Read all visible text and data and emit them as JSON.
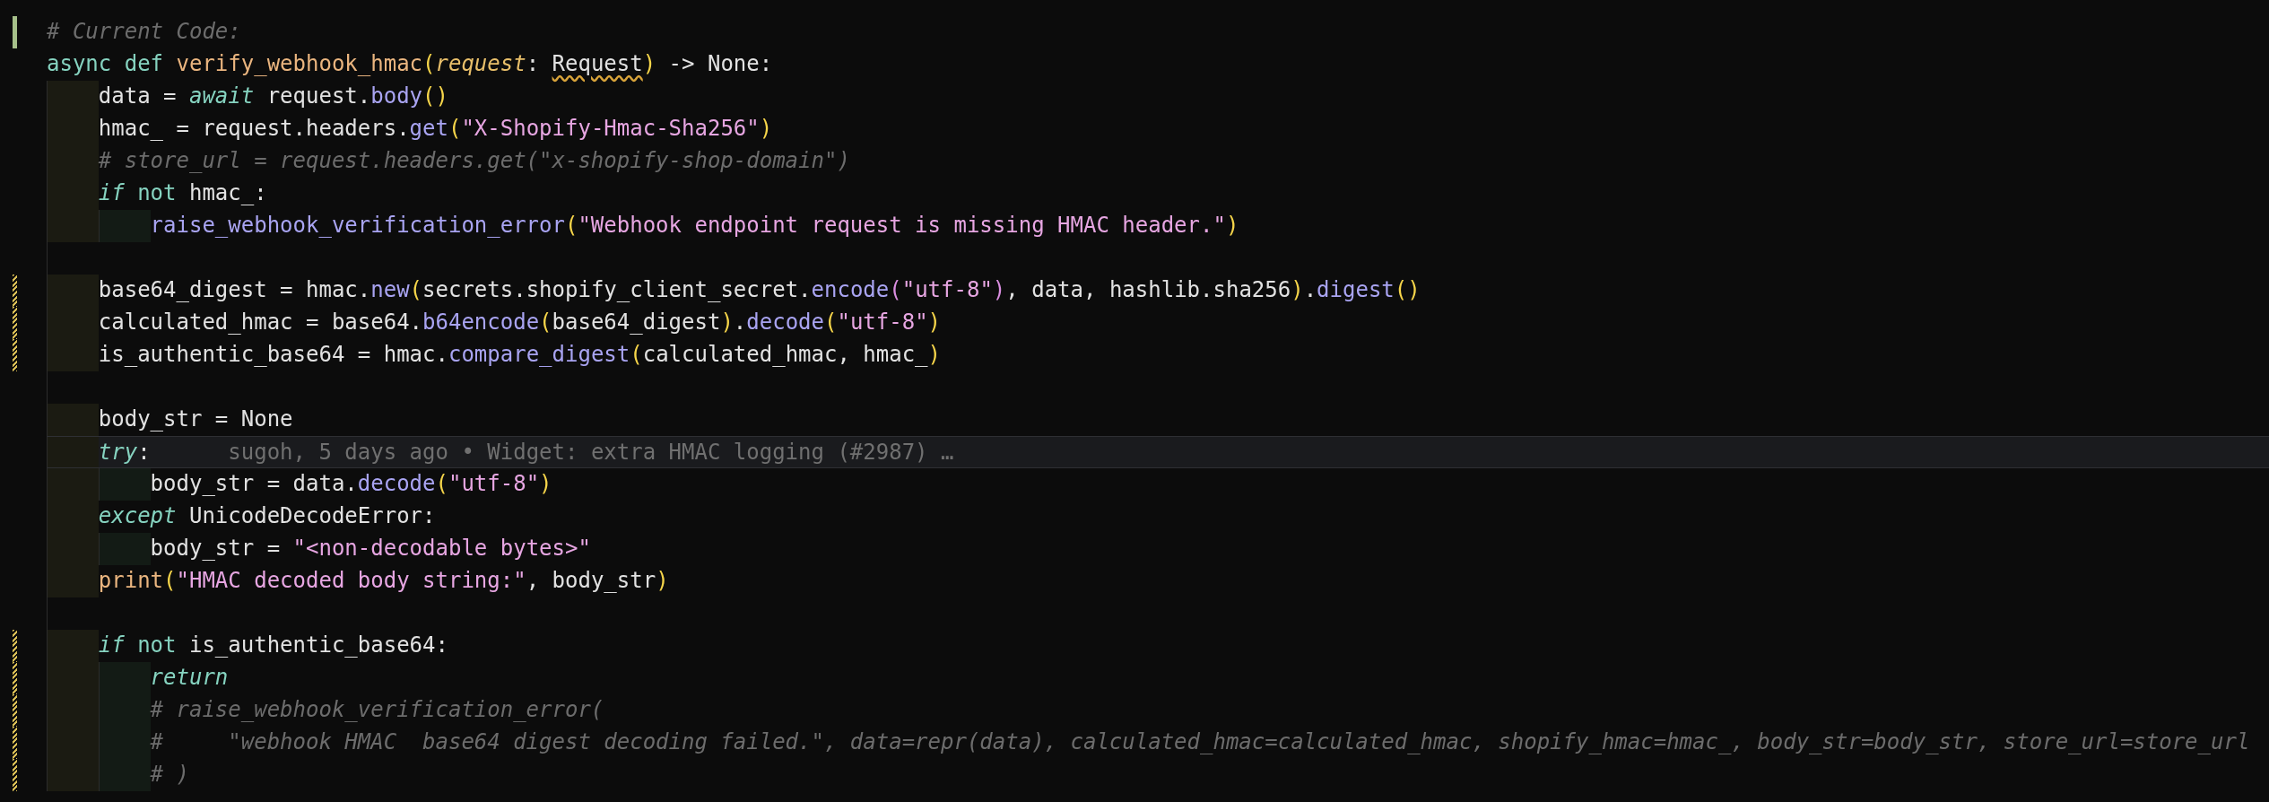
{
  "editor": {
    "lines": [
      {
        "added": true,
        "modified": false,
        "current": false,
        "tokens": [
          {
            "text": "# Current Code:",
            "color": "#6c6c6c",
            "kind": "italic"
          }
        ]
      },
      {
        "added": false,
        "modified": false,
        "current": false,
        "tokens": [
          {
            "text": "async def ",
            "color": "#86d3c0",
            "kind": "plain"
          },
          {
            "text": "verify_webhook_hmac",
            "color": "#eab57f",
            "kind": "plain"
          },
          {
            "text": "(",
            "color": "#f6d54a",
            "kind": "plain"
          },
          {
            "text": "request",
            "color": "#e8bf6a",
            "kind": "italic"
          },
          {
            "text": ": ",
            "color": "#e2e2e2",
            "kind": "plain"
          },
          {
            "text": "Request",
            "color": "#e2e2e2",
            "kind": "warned"
          },
          {
            "text": ")",
            "color": "#f6d54a",
            "kind": "plain"
          },
          {
            "text": " -> None:",
            "color": "#e2e2e2",
            "kind": "plain"
          }
        ],
        "children": [
          {
            "added": false,
            "modified": false,
            "current": false,
            "tokens": [
              {
                "text": "data = ",
                "color": "#e2e2e2",
                "kind": "plain"
              },
              {
                "text": "await",
                "color": "#86d3c0",
                "kind": "italic"
              },
              {
                "text": " request.",
                "color": "#e2e2e2",
                "kind": "plain"
              },
              {
                "text": "body",
                "color": "#a9a4f2",
                "kind": "plain"
              },
              {
                "text": "()",
                "color": "#f6d54a",
                "kind": "plain"
              }
            ]
          },
          {
            "added": false,
            "modified": false,
            "current": false,
            "tokens": [
              {
                "text": "hmac_ = request.headers.",
                "color": "#e2e2e2",
                "kind": "plain"
              },
              {
                "text": "get",
                "color": "#a9a4f2",
                "kind": "plain"
              },
              {
                "text": "(",
                "color": "#f6d54a",
                "kind": "plain"
              },
              {
                "text": "\"X-Shopify-Hmac-Sha256\"",
                "color": "#e7a6e2",
                "kind": "plain"
              },
              {
                "text": ")",
                "color": "#f6d54a",
                "kind": "plain"
              }
            ]
          },
          {
            "added": false,
            "modified": false,
            "current": false,
            "tokens": [
              {
                "text": "# store_url = request.headers.get(\"x-shopify-shop-domain\")",
                "color": "#6c6c6c",
                "kind": "italic"
              }
            ]
          },
          {
            "added": false,
            "modified": false,
            "current": false,
            "tokens": [
              {
                "text": "if",
                "color": "#86d3c0",
                "kind": "italic"
              },
              {
                "text": " not",
                "color": "#86d3c0",
                "kind": "plain"
              },
              {
                "text": " hmac_:",
                "color": "#e2e2e2",
                "kind": "plain"
              }
            ],
            "children": [
              {
                "added": false,
                "modified": false,
                "current": false,
                "tokens": [
                  {
                    "text": "raise_webhook_verification_error",
                    "color": "#a9a4f2",
                    "kind": "plain"
                  },
                  {
                    "text": "(",
                    "color": "#f6d54a",
                    "kind": "plain"
                  },
                  {
                    "text": "\"Webhook endpoint request is missing HMAC header.\"",
                    "color": "#e7a6e2",
                    "kind": "plain"
                  },
                  {
                    "text": ")",
                    "color": "#f6d54a",
                    "kind": "plain"
                  }
                ]
              }
            ]
          },
          {
            "added": false,
            "modified": false,
            "current": false
          },
          {
            "added": false,
            "modified": true,
            "current": false,
            "tokens": [
              {
                "text": "base64_digest = hmac.",
                "color": "#e2e2e2",
                "kind": "plain"
              },
              {
                "text": "new",
                "color": "#a9a4f2",
                "kind": "plain"
              },
              {
                "text": "(",
                "color": "#f6d54a",
                "kind": "plain"
              },
              {
                "text": "secrets.shopify_client_secret.",
                "color": "#e2e2e2",
                "kind": "plain"
              },
              {
                "text": "encode",
                "color": "#a9a4f2",
                "kind": "plain"
              },
              {
                "text": "(",
                "color": "#da8ee0",
                "kind": "plain"
              },
              {
                "text": "\"utf-8\"",
                "color": "#e7a6e2",
                "kind": "plain"
              },
              {
                "text": ")",
                "color": "#da8ee0",
                "kind": "plain"
              },
              {
                "text": ", data, hashlib.sha256",
                "color": "#e2e2e2",
                "kind": "plain"
              },
              {
                "text": ")",
                "color": "#f6d54a",
                "kind": "plain"
              },
              {
                "text": ".",
                "color": "#e2e2e2",
                "kind": "plain"
              },
              {
                "text": "digest",
                "color": "#a9a4f2",
                "kind": "plain"
              },
              {
                "text": "()",
                "color": "#f6d54a",
                "kind": "plain"
              }
            ]
          },
          {
            "added": false,
            "modified": true,
            "current": false,
            "tokens": [
              {
                "text": "calculated_hmac = base64.",
                "color": "#e2e2e2",
                "kind": "plain"
              },
              {
                "text": "b64encode",
                "color": "#a9a4f2",
                "kind": "plain"
              },
              {
                "text": "(",
                "color": "#f6d54a",
                "kind": "plain"
              },
              {
                "text": "base64_digest",
                "color": "#e2e2e2",
                "kind": "plain"
              },
              {
                "text": ")",
                "color": "#f6d54a",
                "kind": "plain"
              },
              {
                "text": ".",
                "color": "#e2e2e2",
                "kind": "plain"
              },
              {
                "text": "decode",
                "color": "#a9a4f2",
                "kind": "plain"
              },
              {
                "text": "(",
                "color": "#f6d54a",
                "kind": "plain"
              },
              {
                "text": "\"utf-8\"",
                "color": "#e7a6e2",
                "kind": "plain"
              },
              {
                "text": ")",
                "color": "#f6d54a",
                "kind": "plain"
              }
            ]
          },
          {
            "added": false,
            "modified": true,
            "current": false,
            "tokens": [
              {
                "text": "is_authentic_base64 = hmac.",
                "color": "#e2e2e2",
                "kind": "plain"
              },
              {
                "text": "compare_digest",
                "color": "#a9a4f2",
                "kind": "plain"
              },
              {
                "text": "(",
                "color": "#f6d54a",
                "kind": "plain"
              },
              {
                "text": "calculated_hmac, hmac_",
                "color": "#e2e2e2",
                "kind": "plain"
              },
              {
                "text": ")",
                "color": "#f6d54a",
                "kind": "plain"
              }
            ]
          },
          {
            "added": false,
            "modified": false,
            "current": false
          },
          {
            "added": false,
            "modified": false,
            "current": false,
            "tokens": [
              {
                "text": "body_str = None",
                "color": "#e2e2e2",
                "kind": "plain"
              }
            ]
          },
          {
            "added": false,
            "modified": false,
            "current": true,
            "blame": "sugoh, 5 days ago • Widget: extra HMAC logging (#2987) …",
            "tokens": [
              {
                "text": "try",
                "color": "#86d3c0",
                "kind": "italic"
              },
              {
                "text": ":",
                "color": "#e2e2e2",
                "kind": "plain"
              }
            ],
            "children": [
              {
                "added": false,
                "modified": false,
                "current": false,
                "tokens": [
                  {
                    "text": "body_str = data.",
                    "color": "#e2e2e2",
                    "kind": "plain"
                  },
                  {
                    "text": "decode",
                    "color": "#a9a4f2",
                    "kind": "plain"
                  },
                  {
                    "text": "(",
                    "color": "#f6d54a",
                    "kind": "plain"
                  },
                  {
                    "text": "\"utf-8\"",
                    "color": "#e7a6e2",
                    "kind": "plain"
                  },
                  {
                    "text": ")",
                    "color": "#f6d54a",
                    "kind": "plain"
                  }
                ]
              }
            ]
          },
          {
            "added": false,
            "modified": false,
            "current": false,
            "tokens": [
              {
                "text": "except",
                "color": "#86d3c0",
                "kind": "italic"
              },
              {
                "text": " UnicodeDecodeError:",
                "color": "#e2e2e2",
                "kind": "plain"
              }
            ],
            "children": [
              {
                "added": false,
                "modified": false,
                "current": false,
                "tokens": [
                  {
                    "text": "body_str = ",
                    "color": "#e2e2e2",
                    "kind": "plain"
                  },
                  {
                    "text": "\"<non-decodable bytes>\"",
                    "color": "#e7a6e2",
                    "kind": "plain"
                  }
                ]
              }
            ]
          },
          {
            "added": false,
            "modified": false,
            "current": false,
            "tokens": [
              {
                "text": "print",
                "color": "#eab57f",
                "kind": "plain"
              },
              {
                "text": "(",
                "color": "#f6d54a",
                "kind": "plain"
              },
              {
                "text": "\"HMAC decoded body string:\"",
                "color": "#e7a6e2",
                "kind": "plain"
              },
              {
                "text": ", body_str",
                "color": "#e2e2e2",
                "kind": "plain"
              },
              {
                "text": ")",
                "color": "#f6d54a",
                "kind": "plain"
              }
            ]
          },
          {
            "added": false,
            "modified": false,
            "current": false
          },
          {
            "added": false,
            "modified": true,
            "current": false,
            "tokens": [
              {
                "text": "if",
                "color": "#86d3c0",
                "kind": "italic"
              },
              {
                "text": " not",
                "color": "#86d3c0",
                "kind": "plain"
              },
              {
                "text": " is_authentic_base64:",
                "color": "#e2e2e2",
                "kind": "plain"
              }
            ],
            "children": [
              {
                "added": false,
                "modified": true,
                "current": false,
                "tokens": [
                  {
                    "text": "return",
                    "color": "#86d3c0",
                    "kind": "italic"
                  }
                ]
              },
              {
                "added": false,
                "modified": true,
                "current": false,
                "tokens": [
                  {
                    "text": "# raise_webhook_verification_error(",
                    "color": "#6c6c6c",
                    "kind": "italic"
                  }
                ]
              },
              {
                "added": false,
                "modified": true,
                "current": false,
                "tokens": [
                  {
                    "text": "#     \"webhook HMAC  base64 digest decoding failed.\", data=repr(data), calculated_hmac=calculated_hmac, shopify_hmac=hmac_, body_str=body_str, store_url=store_url",
                    "color": "#6c6c6c",
                    "kind": "italic"
                  }
                ]
              },
              {
                "added": false,
                "modified": true,
                "current": false,
                "tokens": [
                  {
                    "text": "# )",
                    "color": "#6c6c6c",
                    "kind": "italic"
                  }
                ]
              }
            ]
          }
        ]
      }
    ]
  }
}
